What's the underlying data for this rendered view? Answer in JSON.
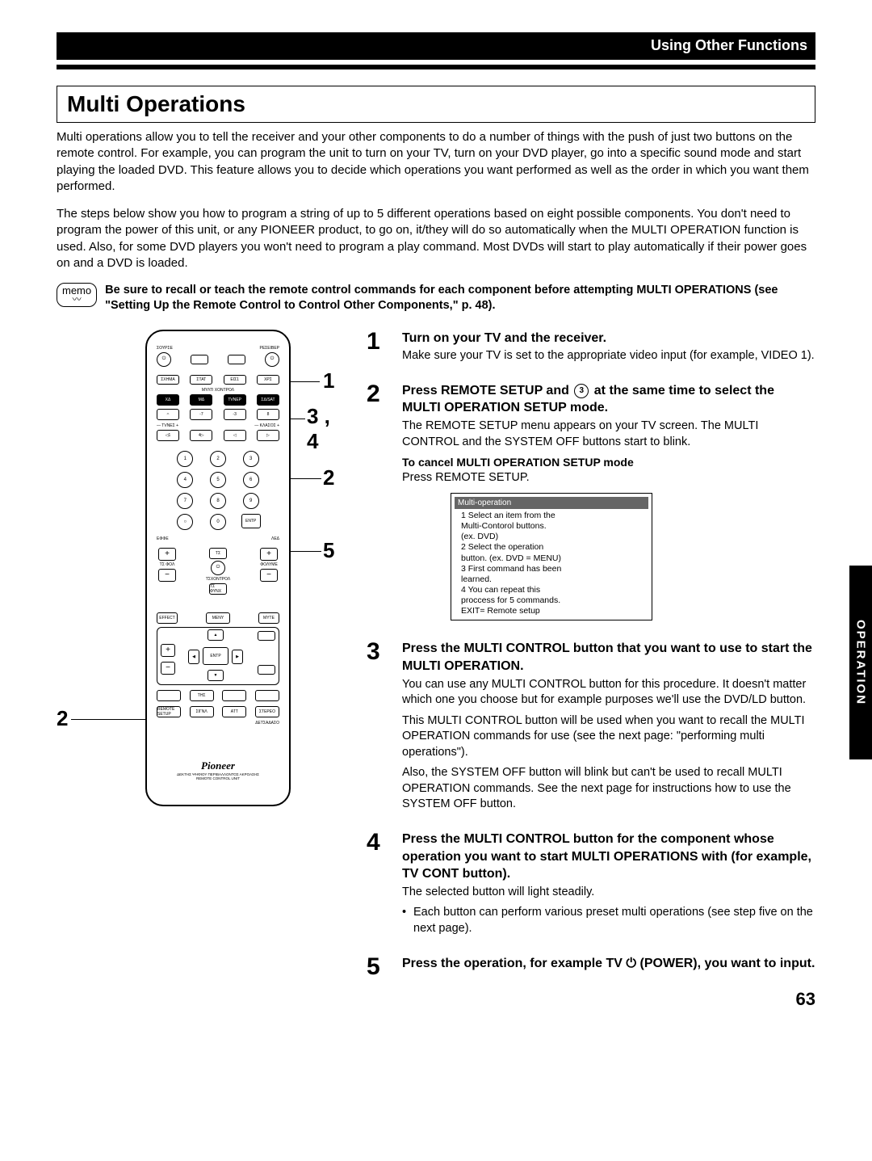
{
  "header": {
    "section": "Using Other Functions"
  },
  "title": "Multi Operations",
  "intro1": "Multi operations allow you to tell the receiver and your other components to do a number of things with the push of just two buttons on the remote control. For example, you can program the unit to turn on your TV, turn on your DVD player, go into a specific sound mode and start playing the loaded DVD. This feature allows you to decide which operations you want performed as well as the order in which you want them performed.",
  "intro2": "The steps below show you how to program a string of up to 5 different operations based on eight possible components. You don't need to program the power of this unit, or any PIONEER product, to go on, it/they will do so automatically when the MULTI OPERATION function is used. Also, for some DVD players you won't need to program a play command. Most DVDs will start to play automatically if their power goes on and a DVD is loaded.",
  "memo": {
    "label": "memo",
    "text": "Be sure to recall or teach the remote control commands for each component before attempting MULTI OPERATIONS (see \"Setting Up the Remote Control to Control Other Components,\" p. 48)."
  },
  "callouts": {
    "left2": "2",
    "r1": "1",
    "r34": "3 , 4",
    "r2": "2",
    "r5": "5"
  },
  "steps": {
    "s1": {
      "num": "1",
      "heading": "Turn on your TV and the receiver.",
      "body1": "Make sure your TV is set to the appropriate video input (for example, VIDEO 1)."
    },
    "s2": {
      "num": "2",
      "heading_a": "Press REMOTE SETUP and ",
      "heading_icon": "3",
      "heading_b": " at the same time to select the MULTI OPERATION SETUP mode.",
      "body1": "The REMOTE SETUP menu appears on your TV screen. The MULTI CONTROL and the SYSTEM OFF buttons start to blink.",
      "sub": "To cancel MULTI OPERATION SETUP mode",
      "body2": "Press REMOTE SETUP.",
      "screen": {
        "title": "Multi-operation",
        "lines": [
          "1 Select an item from the",
          "   Multi-Contorol  buttons.",
          "   (ex. DVD)",
          "2 Select the operation",
          "   button. (ex. DVD  =   MENU)",
          "3 First command has been",
          "   learned.",
          "4 You can repeat this",
          "   proccess for 5 commands.",
          "   EXIT= Remote setup"
        ]
      }
    },
    "s3": {
      "num": "3",
      "heading": "Press the MULTI CONTROL button that you want to use to start the MULTI OPERATION.",
      "body1": "You can use any MULTI CONTROL button for this procedure. It doesn't matter which one you choose but for example purposes we'll use the DVD/LD button.",
      "body2": "This MULTI CONTROL button will be used when you want to recall the MULTI OPERATION commands for use (see the next page: \"performing multi operations\").",
      "body3": "Also, the SYSTEM OFF button will blink but can't be used to recall MULTI OPERATION commands. See the next page for instructions how to use the SYSTEM OFF button."
    },
    "s4": {
      "num": "4",
      "heading": "Press the MULTI CONTROL button for the component whose operation you want to start MULTI OPERATIONS with (for example, TV CONT button).",
      "body1": "The selected button will light steadily.",
      "bullet1": "Each button can perform various preset multi operations (see step five on the next page)."
    },
    "s5": {
      "num": "5",
      "heading_a": "Press the operation, for example TV ",
      "heading_b": " (POWER), you want to input."
    }
  },
  "sideTab": "OPERATION",
  "pageNumber": "63",
  "remoteLabels": {
    "brand": "Pioneer",
    "sub": "ΔΕΚΤΗΣ ΨΗΦΙΟΥ ΠΕΡΙΒΑΛΛΟΝΤΟΣ ΑΚΡΟΑΣΗΣ",
    "sub2": "REMOTE CONTROL UNIT"
  }
}
